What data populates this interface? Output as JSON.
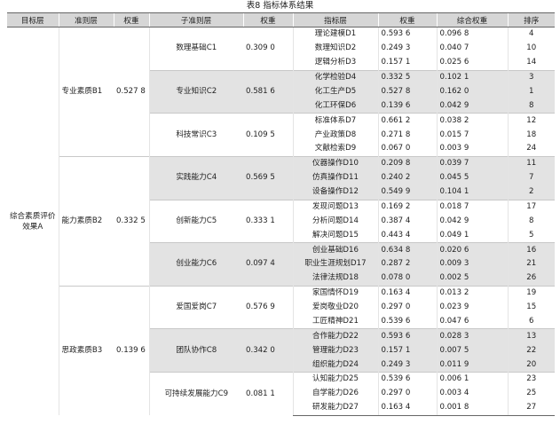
{
  "title": "表8  指标体系结果",
  "headers": [
    "目标层",
    "准则层",
    "权重",
    "子准则层",
    "权重",
    "指标层",
    "权重",
    "综合权重",
    "排序"
  ],
  "goal": "综合素质评价效果A",
  "criteria": [
    {
      "name": "专业素质B1",
      "weight": "0.527 8",
      "subs": [
        {
          "name": "数理基础C1",
          "weight": "0.309 0",
          "shaded": false,
          "indicators": [
            {
              "name": "理论建模D1",
              "weight": "0.593 6",
              "composite": "0.096 8",
              "rank": "4"
            },
            {
              "name": "数理知识D2",
              "weight": "0.249 3",
              "composite": "0.040 7",
              "rank": "10"
            },
            {
              "name": "逻辑分析D3",
              "weight": "0.157 1",
              "composite": "0.025 6",
              "rank": "14"
            }
          ]
        },
        {
          "name": "专业知识C2",
          "weight": "0.581 6",
          "shaded": true,
          "indicators": [
            {
              "name": "化学检验D4",
              "weight": "0.332 5",
              "composite": "0.102 1",
              "rank": "3"
            },
            {
              "name": "化工生产D5",
              "weight": "0.527 8",
              "composite": "0.162 0",
              "rank": "1"
            },
            {
              "name": "化工环保D6",
              "weight": "0.139 6",
              "composite": "0.042 9",
              "rank": "8"
            }
          ]
        },
        {
          "name": "科技常识C3",
          "weight": "0.109 5",
          "shaded": false,
          "indicators": [
            {
              "name": "标准体系D7",
              "weight": "0.661 2",
              "composite": "0.038 2",
              "rank": "12"
            },
            {
              "name": "产业政策D8",
              "weight": "0.271 8",
              "composite": "0.015 7",
              "rank": "18"
            },
            {
              "name": "文献检索D9",
              "weight": "0.067 0",
              "composite": "0.003 9",
              "rank": "24"
            }
          ]
        }
      ]
    },
    {
      "name": "能力素质B2",
      "weight": "0.332 5",
      "subs": [
        {
          "name": "实践能力C4",
          "weight": "0.569 5",
          "shaded": true,
          "indicators": [
            {
              "name": "仪器操作D10",
              "weight": "0.209 8",
              "composite": "0.039 7",
              "rank": "11"
            },
            {
              "name": "仿真操作D11",
              "weight": "0.240 2",
              "composite": "0.045 5",
              "rank": "7"
            },
            {
              "name": "设备操作D12",
              "weight": "0.549 9",
              "composite": "0.104 1",
              "rank": "2"
            }
          ]
        },
        {
          "name": "创新能力C5",
          "weight": "0.333 1",
          "shaded": false,
          "indicators": [
            {
              "name": "发现问题D13",
              "weight": "0.169 2",
              "composite": "0.018 7",
              "rank": "17"
            },
            {
              "name": "分析问题D14",
              "weight": "0.387 4",
              "composite": "0.042 9",
              "rank": "8"
            },
            {
              "name": "解决问题D15",
              "weight": "0.443 4",
              "composite": "0.049 1",
              "rank": "5"
            }
          ]
        },
        {
          "name": "创业能力C6",
          "weight": "0.097 4",
          "shaded": true,
          "indicators": [
            {
              "name": "创业基础D16",
              "weight": "0.634 8",
              "composite": "0.020 6",
              "rank": "16"
            },
            {
              "name": "职业生涯规划D17",
              "weight": "0.287 2",
              "composite": "0.009 3",
              "rank": "21"
            },
            {
              "name": "法律法规D18",
              "weight": "0.078 0",
              "composite": "0.002 5",
              "rank": "26"
            }
          ]
        }
      ]
    },
    {
      "name": "思政素质B3",
      "weight": "0.139 6",
      "subs": [
        {
          "name": "爱国爱岗C7",
          "weight": "0.576 9",
          "shaded": false,
          "indicators": [
            {
              "name": "家国情怀D19",
              "weight": "0.163 4",
              "composite": "0.013 2",
              "rank": "19"
            },
            {
              "name": "爱岗敬业D20",
              "weight": "0.297 0",
              "composite": "0.023 9",
              "rank": "15"
            },
            {
              "name": "工匠精神D21",
              "weight": "0.539 6",
              "composite": "0.047 6",
              "rank": "6"
            }
          ]
        },
        {
          "name": "团队协作C8",
          "weight": "0.342 0",
          "shaded": true,
          "indicators": [
            {
              "name": "合作能力D22",
              "weight": "0.593 6",
              "composite": "0.028 3",
              "rank": "13"
            },
            {
              "name": "管理能力D23",
              "weight": "0.157 1",
              "composite": "0.007 5",
              "rank": "22"
            },
            {
              "name": "组织能力D24",
              "weight": "0.249 3",
              "composite": "0.011 9",
              "rank": "20"
            }
          ]
        },
        {
          "name": "可持续发展能力C9",
          "weight": "0.081 1",
          "shaded": false,
          "indicators": [
            {
              "name": "认知能力D25",
              "weight": "0.539 6",
              "composite": "0.006 1",
              "rank": "23"
            },
            {
              "name": "自学能力D26",
              "weight": "0.297 0",
              "composite": "0.003 4",
              "rank": "25"
            },
            {
              "name": "研发能力D27",
              "weight": "0.163 4",
              "composite": "0.001 8",
              "rank": "27"
            }
          ]
        }
      ]
    }
  ]
}
